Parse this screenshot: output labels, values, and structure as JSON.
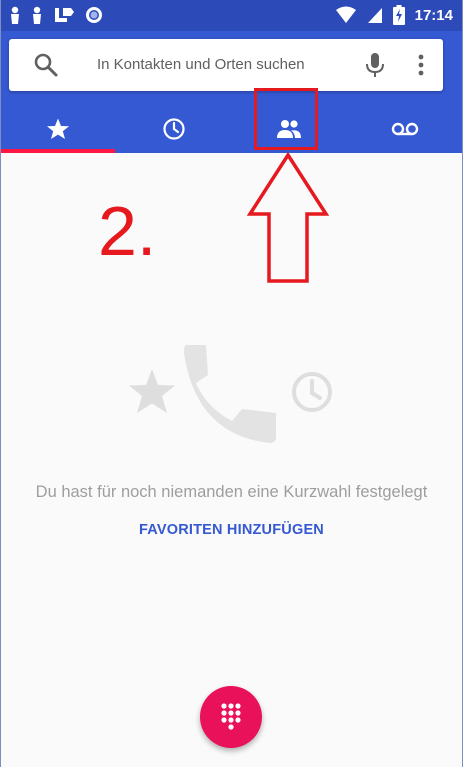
{
  "status_bar": {
    "time": "17:14",
    "left_icons": [
      "person-icon",
      "person-icon",
      "call-forward-icon",
      "circle-icon"
    ],
    "right_icons": [
      "wifi-icon",
      "signal-icon",
      "battery-charging-icon"
    ]
  },
  "search": {
    "placeholder": "In Kontakten und Orten suchen"
  },
  "tabs": [
    {
      "name": "favorites",
      "icon": "star-icon",
      "selected": true
    },
    {
      "name": "recents",
      "icon": "clock-icon",
      "selected": false
    },
    {
      "name": "contacts",
      "icon": "people-icon",
      "selected": false
    },
    {
      "name": "voicemail",
      "icon": "voicemail-icon",
      "selected": false
    }
  ],
  "empty_state": {
    "message": "Du hast für noch niemanden eine Kurzwahl festgelegt",
    "action_label": "FAVORITEN HINZUFÜGEN"
  },
  "annotation": {
    "step_label": "2."
  },
  "colors": {
    "status_bar": "#2c4bb8",
    "app_bar": "#3558d3",
    "tab_indicator": "#ff1744",
    "fab": "#e8115a",
    "annotation": "#e5191e"
  }
}
